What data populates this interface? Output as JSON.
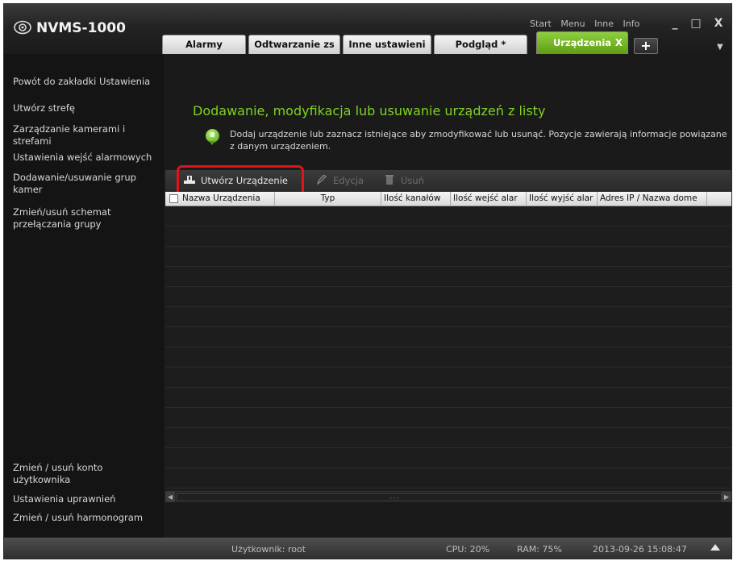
{
  "app": {
    "title": "NVMS-1000"
  },
  "top_menu": [
    "Start",
    "Menu",
    "Inne",
    "Info"
  ],
  "window_controls": {
    "minimize": "_",
    "maximize": "□",
    "close": "X"
  },
  "tabs": [
    {
      "label": "Alarmy",
      "active": false
    },
    {
      "label": "Odtwarzanie zs",
      "active": false
    },
    {
      "label": "Inne ustawieni",
      "active": false
    },
    {
      "label": "Podgląd *",
      "active": false
    },
    {
      "label": "Urządzenia",
      "active": true
    }
  ],
  "tab_close": "X",
  "tab_add": "+",
  "sidebar": {
    "back_link": "Powót do zakładki Ustawienia",
    "items": [
      "Utwórz strefę",
      "Zarządzanie kamerami i strefami",
      "Ustawienia wejść alarmowych",
      "Dodawanie/usuwanie grup kamer",
      "Zmień/usuń schemat przełączania grupy"
    ],
    "bottom_items": [
      "Zmień / usuń konto użytkownika",
      "Ustawienia uprawnień",
      "Zmień / usuń harmonogram"
    ]
  },
  "main": {
    "heading": "Dodawanie, modyfikacja lub usuwanie urządzeń z listy",
    "info": "Dodaj urządzenie lub zaznacz istniejące aby zmodyfikować lub usunąć. Pozycje zawierają informacje powiązane z danym urządzeniem."
  },
  "toolbar": {
    "create": "Utwórz Urządzenie",
    "edit": "Edycja",
    "delete": "Usuń"
  },
  "table": {
    "columns": [
      "Nazwa Urządzenia",
      "Typ",
      "Ilość kanałów",
      "Ilość wejść alar",
      "Ilość wyjść alar",
      "Adres IP / Nazwa dome"
    ],
    "rows": []
  },
  "status": {
    "user": "Użytkownik: root",
    "cpu": "CPU: 20%",
    "ram": "RAM: 75%",
    "datetime": "2013-09-26 15:08:47"
  },
  "colors": {
    "accent": "#7ed321",
    "highlight_box": "#e0141b",
    "active_tab": "#6db325"
  }
}
